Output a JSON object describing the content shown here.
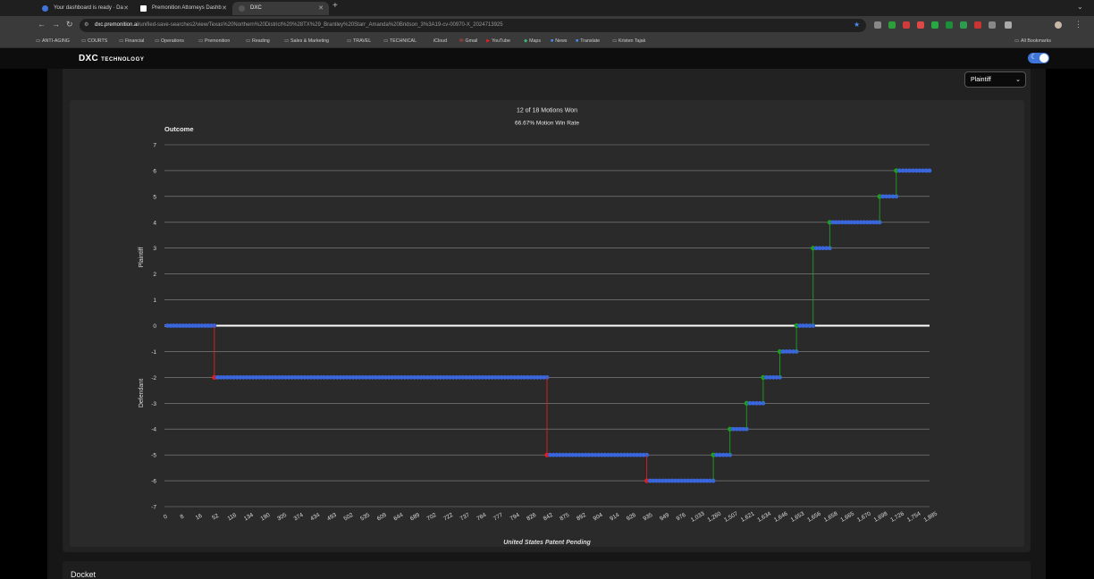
{
  "browser": {
    "tabs": [
      {
        "title": "Your dashboard is ready · Da",
        "active": false,
        "icon_color": "#3f74d8"
      },
      {
        "title": "Premonition Attorneys Dashb",
        "active": false,
        "icon_color": "#ffffff"
      },
      {
        "title": "DXC",
        "active": true,
        "icon_color": "#555555"
      }
    ],
    "new_tab": "+",
    "url_domain": "dxc.premonition.ai",
    "url_path": "/unified-save-searches2/view/Texas%20Northern%20District%20%28TX%29_Brantley%20Starr_Amanda%20Bridson_3%3A19-cv-00970-X_2024713925",
    "bookmarks": [
      "ANTI-AGING",
      "COURTS",
      "Financial",
      "Operations",
      "Premonition",
      "Reading",
      "Sales & Marketing",
      "TRAVEL",
      "TECHNICAL",
      "iCloud",
      "Gmail",
      "YouTube",
      "Maps",
      "News",
      "Translate",
      "Kristen Tajak"
    ],
    "all_bookmarks": "All Bookmarks"
  },
  "app": {
    "logo_mark": "DXC",
    "logo_text": "TECHNOLOGY",
    "party_select": "Plaintiff"
  },
  "chart_data": {
    "type": "line",
    "title": "12 of 18 Motions Won",
    "subtitle": "66.67% Motion Win Rate",
    "outcome_label": "Outcome",
    "ylabel_top": "Plaintiff",
    "ylabel_bottom": "Defendant",
    "footer": "United States Patent Pending",
    "ylim": [
      -7,
      7
    ],
    "yticks": [
      "7",
      "6",
      "5",
      "4",
      "3",
      "2",
      "1",
      "0",
      "-1",
      "-2",
      "-3",
      "-4",
      "-5",
      "-6",
      "-7"
    ],
    "xticks": [
      "0",
      "8",
      "16",
      "52",
      "116",
      "134",
      "190",
      "305",
      "374",
      "434",
      "493",
      "502",
      "535",
      "609",
      "644",
      "689",
      "702",
      "722",
      "737",
      "764",
      "777",
      "794",
      "826",
      "842",
      "875",
      "892",
      "904",
      "914",
      "926",
      "935",
      "949",
      "976",
      "1,033",
      "1,260",
      "1,507",
      "1,621",
      "1,634",
      "1,646",
      "1,653",
      "1,656",
      "1,658",
      "1,665",
      "1,670",
      "1,698",
      "1,726",
      "1,754",
      "1,885"
    ],
    "grid": true,
    "colors": {
      "won": "#1fa01f",
      "lost": "#e02020",
      "neutral": "#2233ee",
      "points": "#3a66dd",
      "zero_line": "#ffffff"
    },
    "segments": [
      {
        "x0": 0,
        "x1": 52,
        "y": 0,
        "change": "none"
      },
      {
        "x0": 52,
        "x1": 842,
        "y": -2,
        "change": "lost"
      },
      {
        "x0": 842,
        "x1": 935,
        "y": -5,
        "change": "lost"
      },
      {
        "x0": 935,
        "x1": 1260,
        "y": -6,
        "change": "lost"
      },
      {
        "x0": 1260,
        "x1": 1507,
        "y": -5,
        "change": "won"
      },
      {
        "x0": 1507,
        "x1": 1621,
        "y": -4,
        "change": "won"
      },
      {
        "x0": 1621,
        "x1": 1634,
        "y": -3,
        "change": "won"
      },
      {
        "x0": 1634,
        "x1": 1646,
        "y": -2,
        "change": "won"
      },
      {
        "x0": 1646,
        "x1": 1653,
        "y": -1,
        "change": "won"
      },
      {
        "x0": 1653,
        "x1": 1656,
        "y": 0,
        "change": "won"
      },
      {
        "x0": 1656,
        "x1": 1658,
        "y": 3,
        "change": "won"
      },
      {
        "x0": 1658,
        "x1": 1698,
        "y": 4,
        "change": "won"
      },
      {
        "x0": 1698,
        "x1": 1726,
        "y": 5,
        "change": "won"
      },
      {
        "x0": 1726,
        "x1": 1885,
        "y": 6,
        "change": "won"
      }
    ]
  },
  "docket": {
    "title": "Docket"
  }
}
